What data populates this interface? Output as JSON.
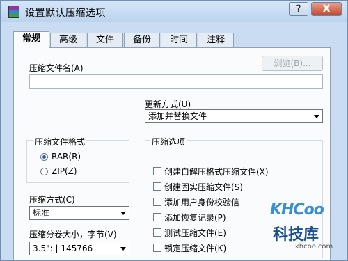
{
  "window": {
    "title": "设置默认压缩选项",
    "help_label": "?",
    "close_label": "X"
  },
  "tabs": [
    {
      "label": "常规"
    },
    {
      "label": "高级"
    },
    {
      "label": "文件"
    },
    {
      "label": "备份"
    },
    {
      "label": "时间"
    },
    {
      "label": "注释"
    }
  ],
  "archive_name": {
    "label": "压缩文件名(A)",
    "value": "",
    "browse_label": "浏览(B)..."
  },
  "update_mode": {
    "label": "更新方式(U)",
    "selected": "添加并替换文件"
  },
  "format": {
    "label": "压缩文件格式",
    "options": [
      {
        "label": "RAR(R)",
        "checked": true
      },
      {
        "label": "ZIP(Z)",
        "checked": false
      }
    ]
  },
  "options": {
    "label": "压缩选项",
    "items": [
      {
        "label": "创建自解压格式压缩文件(X)"
      },
      {
        "label": "创建固实压缩文件(S)"
      },
      {
        "label": "添加用户身份校验信"
      },
      {
        "label": "添加恢复记录(P)"
      },
      {
        "label": "测试压缩文件(E)"
      },
      {
        "label": "锁定压缩文件(K)"
      }
    ]
  },
  "method": {
    "label": "压缩方式(C)",
    "selected": "标准"
  },
  "split": {
    "label": "压缩分卷大小，字节(V)",
    "selected": "3.5\": | 145766"
  },
  "watermark": {
    "logo": "KHCoo",
    "text": "科技库",
    "url": "khcoo.com"
  }
}
